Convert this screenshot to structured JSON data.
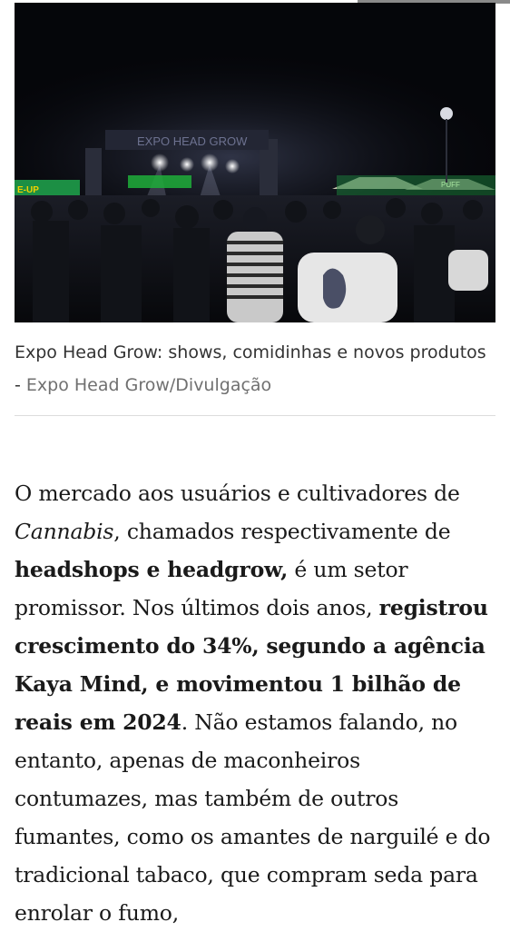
{
  "photo": {
    "alt": "Expo Head Grow: shows, comidinhas e novos produtos",
    "stage_sign": "EXPO HEAD GROW",
    "banner_left": "E-UP",
    "banner_right": "PUFF"
  },
  "caption": {
    "text": "Expo Head Grow: shows, comidinhas e novos produtos",
    "separator": " - ",
    "credit": "Expo Head Grow/Divulgação"
  },
  "article": {
    "p1_a": "O mercado aos usuários e cultivadores de ",
    "p1_b_italic": "Cannabis",
    "p1_c": ", chamados respectivamente de ",
    "p1_d_bold": "headshops e headgrow,",
    "p1_e": " é um setor promissor. Nos últimos dois anos, ",
    "p1_f_bold": "registrou crescimento do 34%, segundo a agência Kaya Mind, e movimentou 1 bilhão de reais em 2024",
    "p1_g": ". Não estamos falando, no entanto, apenas de maconheiros contumazes, mas também de outros fumantes, como os amantes de narguilé e do tradicional tabaco, que compram seda para enrolar o fumo,"
  },
  "colors": {
    "caption_text": "#333333",
    "credit_text": "#707070",
    "body_text": "#1a1a1a",
    "divider": "#dcdcdc"
  }
}
